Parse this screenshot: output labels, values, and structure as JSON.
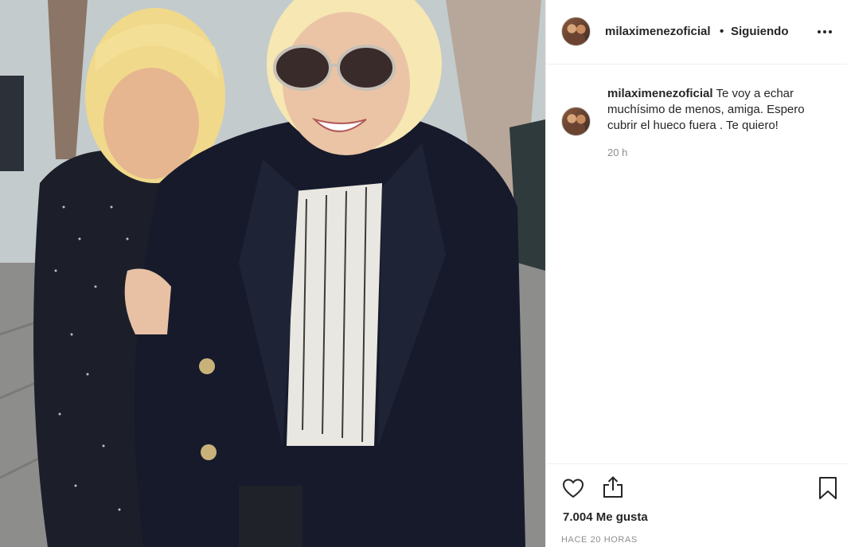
{
  "post": {
    "photo_alt": "photo",
    "header": {
      "username": "milaximenezoficial",
      "separator": "•",
      "follow_status": "Siguiendo",
      "more_icon": "more-horizontal-icon"
    },
    "caption": {
      "username": "milaximenezoficial",
      "text": " Te voy a echar muchísimo de menos, amiga. Espero cubrir el hueco fuera . Te quiero!",
      "time": "20 h"
    },
    "actions": {
      "like_icon": "heart-icon",
      "share_icon": "share-icon",
      "save_icon": "bookmark-icon"
    },
    "likes": "7.004 Me gusta",
    "posted": "HACE 20 HORAS"
  }
}
